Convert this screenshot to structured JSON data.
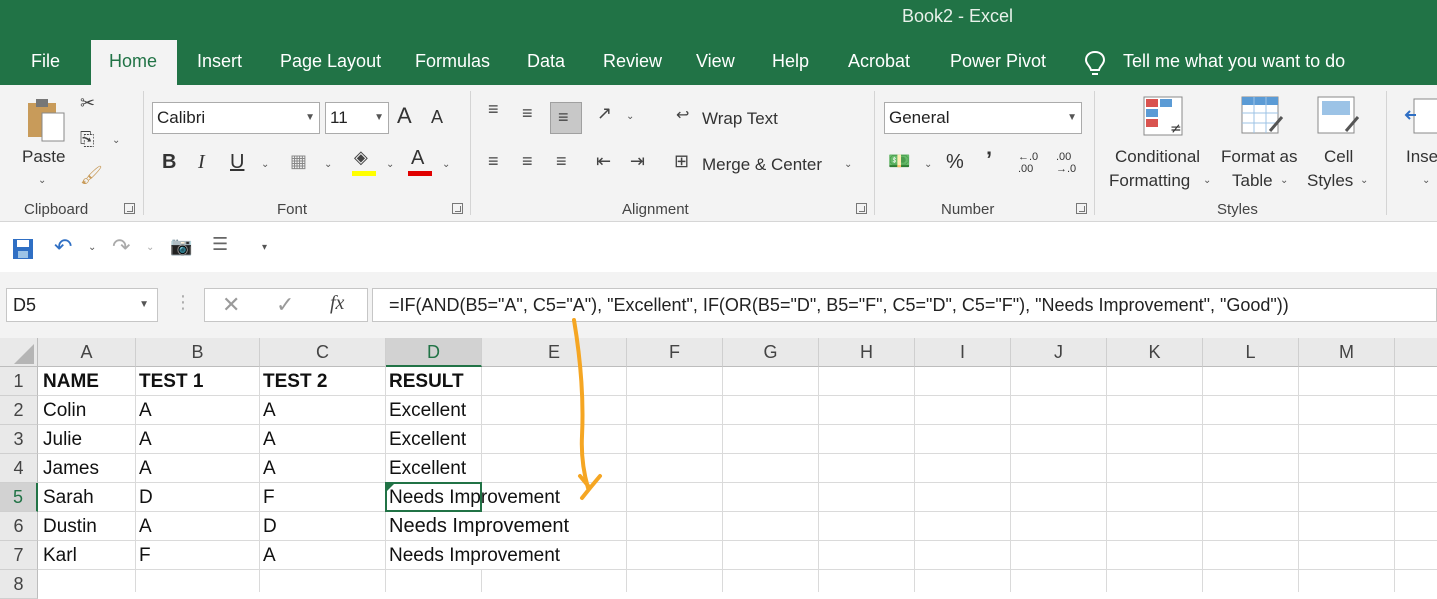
{
  "window": {
    "title": "Book2  -  Excel"
  },
  "tabs": [
    "File",
    "Home",
    "Insert",
    "Page Layout",
    "Formulas",
    "Data",
    "Review",
    "View",
    "Help",
    "Acrobat",
    "Power Pivot"
  ],
  "tell_me": "Tell me what you want to do",
  "ribbon": {
    "clipboard": {
      "paste": "Paste",
      "label": "Clipboard"
    },
    "font": {
      "name": "Calibri",
      "size": "11",
      "label": "Font",
      "bold": "B",
      "italic": "I",
      "underline": "U",
      "grow": "A",
      "shrink": "A",
      "font_color": "A"
    },
    "alignment": {
      "wrap_text": "Wrap Text",
      "merge_center": "Merge & Center",
      "label": "Alignment"
    },
    "number": {
      "format": "General",
      "percent": "%",
      "comma": "’",
      "inc_dec": "←.0 .00",
      "dec_dec": ".00 →.0",
      "label": "Number"
    },
    "styles": {
      "conditional": "Conditional",
      "formatting": "Formatting",
      "format_as": "Format as",
      "table": "Table",
      "cell": "Cell",
      "styles": "Styles",
      "label": "Styles"
    },
    "cells": {
      "insert": "Inse"
    }
  },
  "formula_bar": {
    "name_box": "D5",
    "fx": "fx",
    "formula": "=IF(AND(B5=\"A\", C5=\"A\"), \"Excellent\", IF(OR(B5=\"D\", B5=\"F\", C5=\"D\", C5=\"F\"), \"Needs Improvement\", \"Good\"))"
  },
  "sheet": {
    "columns": [
      "A",
      "B",
      "C",
      "D",
      "E",
      "F",
      "G",
      "H",
      "I",
      "J",
      "K",
      "L",
      "M"
    ],
    "rows": [
      "1",
      "2",
      "3",
      "4",
      "5",
      "6",
      "7",
      "8"
    ],
    "cells": [
      [
        "NAME",
        "TEST 1",
        "TEST 2",
        "RESULT"
      ],
      [
        "Colin",
        "A",
        "A",
        "Excellent"
      ],
      [
        "Julie",
        "A",
        "A",
        "Excellent"
      ],
      [
        "James",
        "A",
        "A",
        "Excellent"
      ],
      [
        "Sarah",
        "D",
        "F",
        "Needs Improvement"
      ],
      [
        "Dustin",
        "A",
        "D",
        "Needs Improvement"
      ],
      [
        "Karl",
        "F",
        "A",
        "Needs Improvement"
      ]
    ]
  },
  "colors": {
    "excel_green": "#217346",
    "annotation": "#f5a623"
  }
}
